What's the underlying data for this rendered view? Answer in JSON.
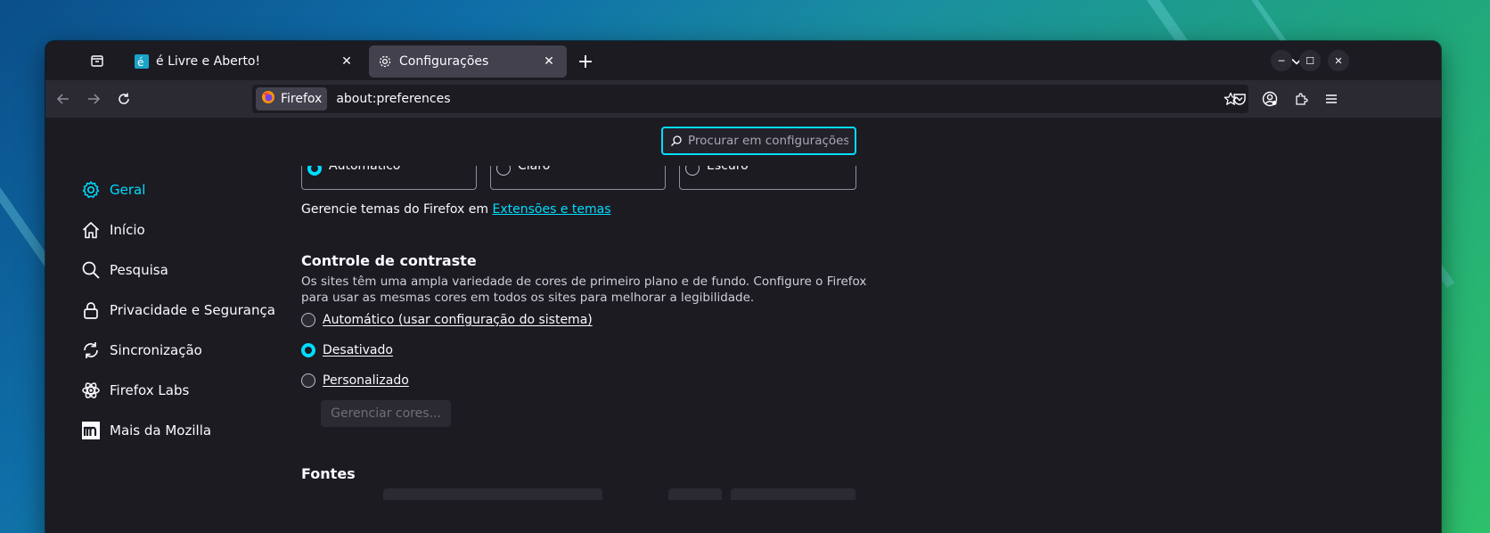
{
  "tabs": [
    {
      "label": "é Livre e Aberto!",
      "favicon": "site-e-icon",
      "active": false
    },
    {
      "label": "Configurações",
      "favicon": "gear-icon",
      "active": true
    }
  ],
  "navbar": {
    "identity_label": "Firefox",
    "url": "about:preferences"
  },
  "search": {
    "placeholder": "Procurar em configurações"
  },
  "sidebar": {
    "items": [
      {
        "label": "Geral",
        "icon": "gear-icon",
        "active": true
      },
      {
        "label": "Início",
        "icon": "home-icon"
      },
      {
        "label": "Pesquisa",
        "icon": "search-icon"
      },
      {
        "label": "Privacidade e Segurança",
        "icon": "lock-icon"
      },
      {
        "label": "Sincronização",
        "icon": "sync-icon"
      },
      {
        "label": "Firefox Labs",
        "icon": "labs-icon"
      },
      {
        "label": "Mais da Mozilla",
        "icon": "mozilla-icon"
      }
    ]
  },
  "themes": {
    "options": [
      "Automático",
      "Claro",
      "Escuro"
    ],
    "selected": "Automático",
    "manage_prefix": "Gerencie temas do Firefox em ",
    "manage_link": "Extensões e temas"
  },
  "contrast": {
    "title": "Controle de contraste",
    "description": "Os sites têm uma ampla variedade de cores de primeiro plano e de fundo. Configure o Firefox para usar as mesmas cores em todos os sites para melhorar a legibilidade.",
    "options": [
      {
        "label": "Automático (usar configuração do sistema)",
        "selected": false
      },
      {
        "label": "Desativado",
        "selected": true
      },
      {
        "label": "Personalizado",
        "selected": false
      }
    ],
    "manage_colors": "Gerenciar cores..."
  },
  "fonts": {
    "title": "Fontes"
  },
  "colors": {
    "accent": "#00ddff",
    "bg": "#1c1b22",
    "toolbar": "#2b2a33"
  }
}
